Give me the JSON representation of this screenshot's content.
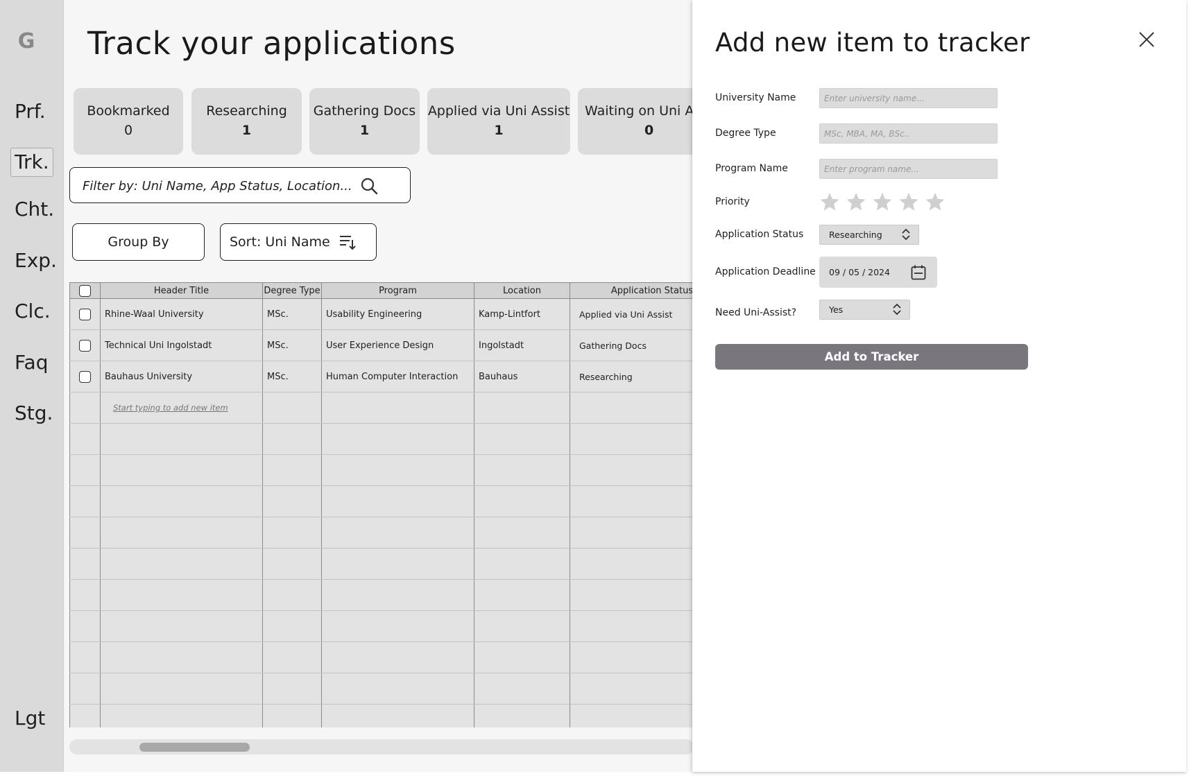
{
  "sidebar": {
    "logo": "G",
    "items": [
      {
        "label": "Prf.",
        "active": false
      },
      {
        "label": "Trk.",
        "active": true
      },
      {
        "label": "Cht.",
        "active": false
      },
      {
        "label": "Exp.",
        "active": false
      },
      {
        "label": "Clc.",
        "active": false
      },
      {
        "label": "Faq",
        "active": false
      },
      {
        "label": "Stg.",
        "active": false
      }
    ],
    "logout": "Lgt"
  },
  "main": {
    "title": "Track your applications",
    "status_cards": [
      {
        "label": "Bookmarked",
        "count": "0"
      },
      {
        "label": "Researching",
        "count": "1"
      },
      {
        "label": "Gathering Docs",
        "count": "1"
      },
      {
        "label": "Applied via Uni Assist",
        "count": "1"
      },
      {
        "label": "Waiting on Uni Assist",
        "count": "0"
      }
    ],
    "filter_placeholder": "Filter by: Uni Name, App Status, Location...",
    "group_by_label": "Group By",
    "sort_label": "Sort: Uni Name",
    "table": {
      "columns": [
        "Header Title",
        "Degree Type",
        "Program",
        "Location",
        "Application Status"
      ],
      "rows": [
        {
          "university": "Rhine-Waal University",
          "degree": "MSc.",
          "program": "Usability Engineering",
          "location": "Kamp-Lintfort",
          "status": "Applied via Uni Assist"
        },
        {
          "university": "Technical Uni Ingolstadt",
          "degree": "MSc.",
          "program": "User Experience Design",
          "location": "Ingolstadt",
          "status": "Gathering Docs"
        },
        {
          "university": "Bauhaus University",
          "degree": "MSc.",
          "program": "Human Computer Interaction",
          "location": "Bauhaus",
          "status": "Researching"
        }
      ],
      "add_hint": "Start typing to add new item"
    }
  },
  "drawer": {
    "title": "Add new item to tracker",
    "fields": {
      "university_label": "University Name",
      "university_placeholder": "Enter university name...",
      "degree_label": "Degree Type",
      "degree_placeholder": "MSc, MBA, MA, BSc..",
      "program_label": "Program Name",
      "program_placeholder": "Enter program name...",
      "priority_label": "Priority",
      "priority_rating": 0,
      "priority_max": 5,
      "status_label": "Application Status",
      "status_value": "Researching",
      "deadline_label": "Application Deadline",
      "deadline_value": "09 / 05 / 2024",
      "uni_assist_label": "Need Uni-Assist?",
      "uni_assist_value": "Yes"
    },
    "submit_label": "Add to Tracker"
  },
  "colors": {
    "sidebar_bg": "#dadada",
    "card_bg": "#dcdcdc",
    "primary_button": "#79767d",
    "star_inactive": "#cfcfcf"
  }
}
